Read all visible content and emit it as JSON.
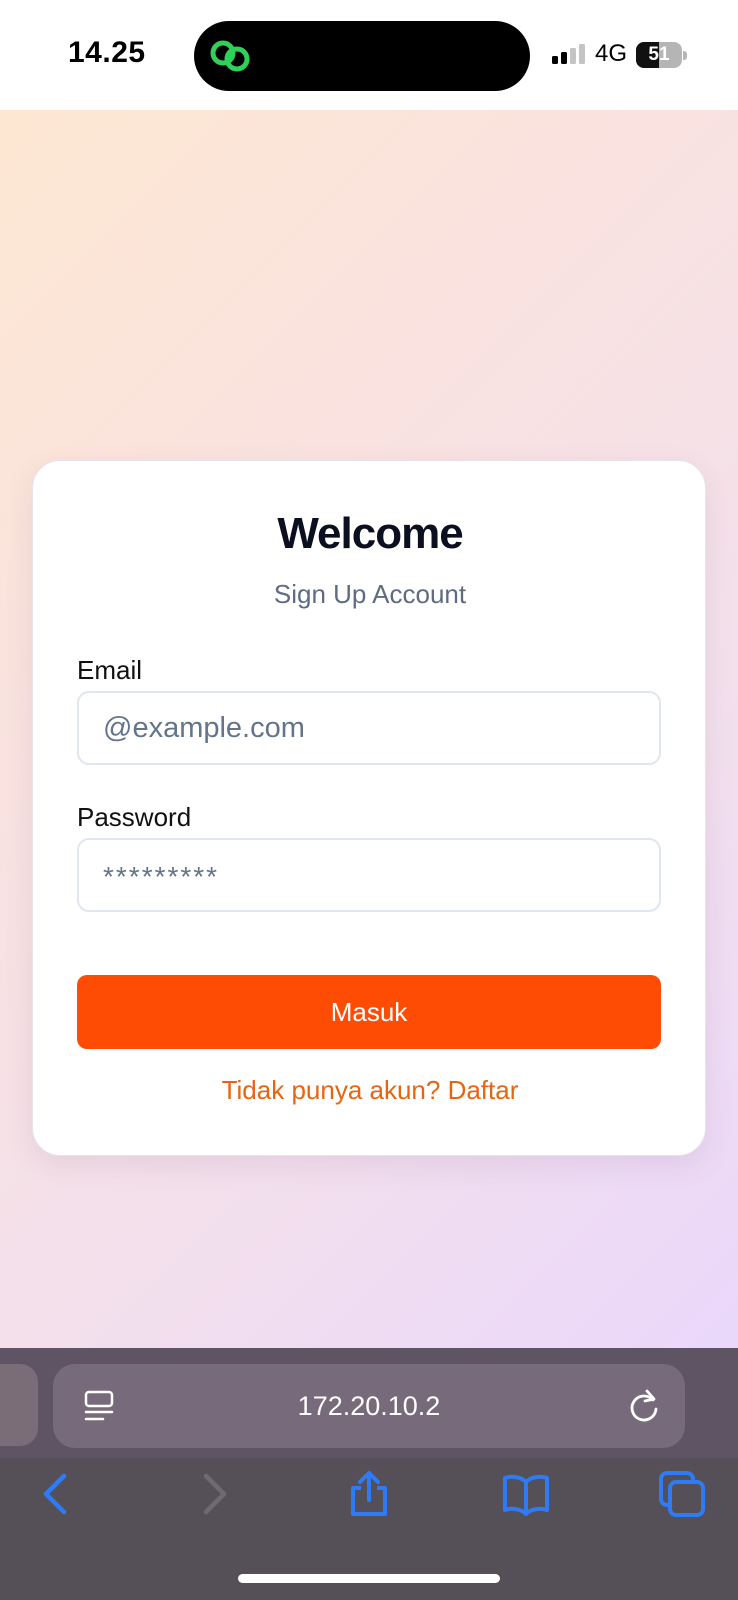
{
  "status_bar": {
    "time": "14.25",
    "network": "4G",
    "battery_level": "51"
  },
  "login": {
    "title": "Welcome",
    "subtitle": "Sign Up Account",
    "email_label": "Email",
    "email_placeholder": "@example.com",
    "password_label": "Password",
    "password_placeholder": "*********",
    "submit_label": "Masuk",
    "signup_link": "Tidak punya akun? Daftar"
  },
  "browser": {
    "url": "172.20.10.2"
  },
  "colors": {
    "accent": "#ff4c05",
    "link": "#e8650f",
    "safari_blue": "#2f7bf6"
  },
  "icons": {
    "dynamic_island": "link-app-icon",
    "reader": "reader-mode-icon",
    "reload": "reload-icon",
    "back": "back-chevron-icon",
    "forward": "forward-chevron-icon",
    "share": "share-icon",
    "bookmarks": "book-icon",
    "tabs": "tabs-icon"
  }
}
